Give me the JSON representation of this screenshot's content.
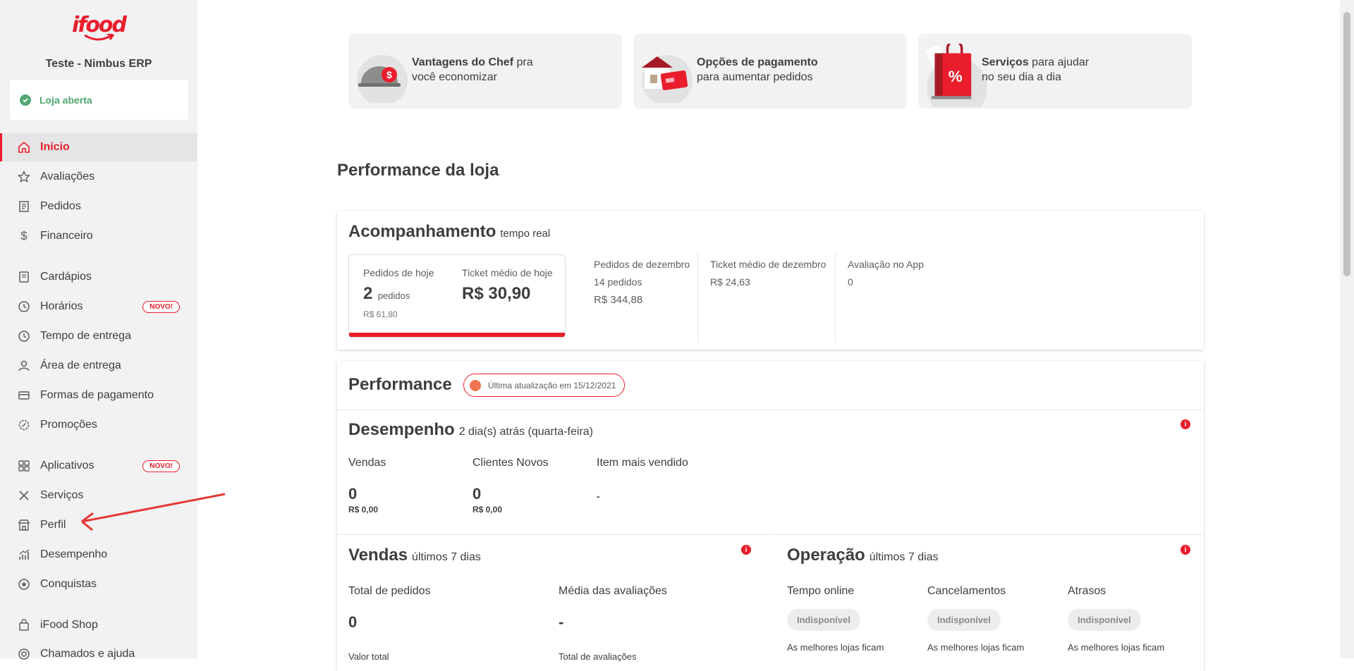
{
  "sidebar": {
    "logo": "ifood",
    "store_name": "Teste - Nimbus ERP",
    "status": "Loja aberta",
    "items": [
      {
        "label": "Início",
        "icon": "home-icon"
      },
      {
        "label": "Avaliações",
        "icon": "star-icon"
      },
      {
        "label": "Pedidos",
        "icon": "receipt-icon"
      },
      {
        "label": "Financeiro",
        "icon": "dollar-icon"
      },
      {
        "label": "Cardápios",
        "icon": "menu-book-icon"
      },
      {
        "label": "Horários",
        "icon": "clock-icon",
        "badge": "NOVO!"
      },
      {
        "label": "Tempo de entrega",
        "icon": "clock-icon"
      },
      {
        "label": "Área de entrega",
        "icon": "location-icon"
      },
      {
        "label": "Formas de pagamento",
        "icon": "card-icon"
      },
      {
        "label": "Promoções",
        "icon": "promo-icon"
      },
      {
        "label": "Aplicativos",
        "icon": "apps-icon",
        "badge": "NOVO!"
      },
      {
        "label": "Serviços",
        "icon": "tools-icon"
      },
      {
        "label": "Perfil",
        "icon": "store-icon"
      },
      {
        "label": "Desempenho",
        "icon": "chart-icon"
      },
      {
        "label": "Conquistas",
        "icon": "medal-icon"
      },
      {
        "label": "iFood Shop",
        "icon": "bag-icon"
      },
      {
        "label": "Chamados e ajuda",
        "icon": "help-icon"
      }
    ]
  },
  "promos": [
    {
      "bold": "Vantagens do Chef",
      "rest1": " pra",
      "line2": "você economizar"
    },
    {
      "bold": "Opções de pagamento",
      "rest1": "",
      "line2": "para aumentar pedidos"
    },
    {
      "bold": "Serviços",
      "rest1": " para ajudar",
      "line2": "no seu dia a dia"
    }
  ],
  "performance_title": "Performance da loja",
  "acompanhamento": {
    "title": "Acompanhamento",
    "subtitle": "tempo real",
    "today_orders_label": "Pedidos de hoje",
    "today_orders_value": "2",
    "today_orders_unit": "pedidos",
    "today_total": "R$ 61,80",
    "today_ticket_label": "Ticket médio de hoje",
    "today_ticket_value": "R$ 30,90",
    "dec_orders_label": "Pedidos de dezembro",
    "dec_orders_count": "14 pedidos",
    "dec_orders_total": "R$ 344,88",
    "dec_ticket_label": "Ticket médio de dezembro",
    "dec_ticket_value": "R$ 24,63",
    "rating_label": "Avaliação no App",
    "rating_value": "0"
  },
  "performance": {
    "title": "Performance",
    "badge": "Última atualização em 15/12/2021",
    "desempenho_title": "Desempenho",
    "desempenho_sub": "2 dia(s) atrás (quarta-feira)",
    "vendas_label": "Vendas",
    "vendas_value": "0",
    "vendas_money": "R$ 0,00",
    "clientes_label": "Clientes Novos",
    "clientes_value": "0",
    "clientes_money": "R$ 0,00",
    "item_label": "Item mais vendido",
    "item_value": "-",
    "vendas7_title": "Vendas",
    "vendas7_sub": "últimos 7 dias",
    "total_pedidos_label": "Total de pedidos",
    "total_pedidos_value": "0",
    "valor_total_label": "Valor total",
    "media_label": "Média das avaliações",
    "media_value": "-",
    "total_aval_label": "Total de avaliações",
    "operacao_title": "Operação",
    "operacao_sub": "últimos 7 dias",
    "tempo_online_label": "Tempo online",
    "cancelamentos_label": "Cancelamentos",
    "atrasos_label": "Atrasos",
    "indisponivel": "Indisponível",
    "melhores": "As melhores lojas ficam"
  },
  "colors": {
    "brand": "#ea1d2c",
    "success": "#50a773"
  }
}
